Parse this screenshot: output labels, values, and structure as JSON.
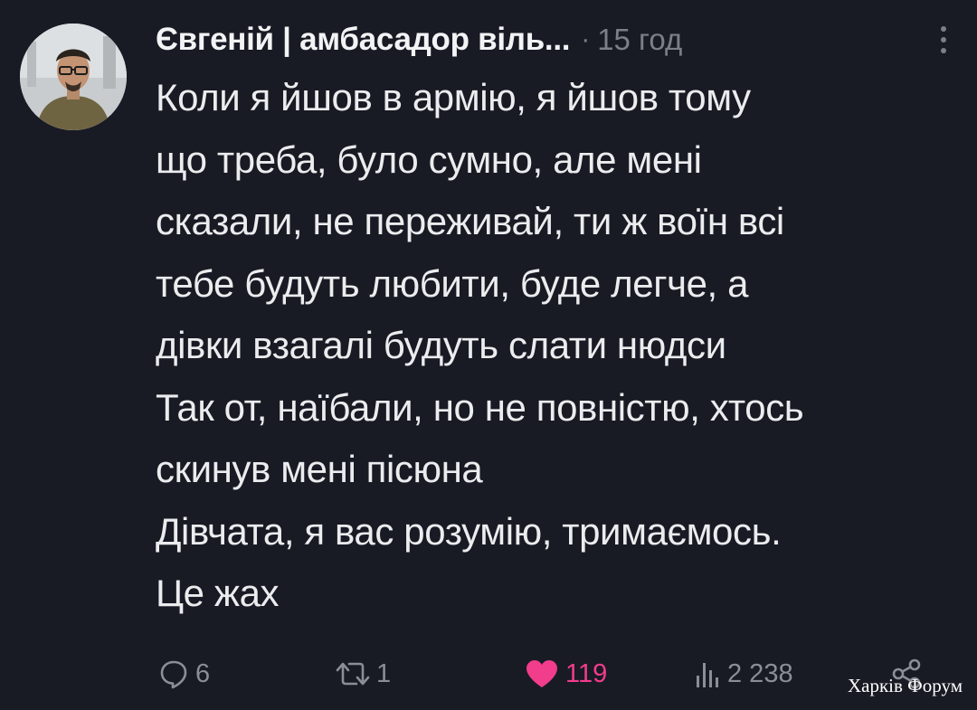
{
  "post": {
    "author": "Євгеній | амбасадор віль...",
    "separator": "·",
    "time": "15 год",
    "lines": [
      "Коли я йшов в армію, я йшов тому",
      "що треба, було сумно, але мені",
      "сказали, не переживай, ти ж воїн всі",
      "тебе будуть любити, буде легче, а",
      "дівки взагалі будуть слати нюдси",
      "Так от, наїбали, но не повністю, хтось",
      "скинув мені пісюна",
      "Дівчата, я вас розумію, тримаємось.",
      "Це жах"
    ]
  },
  "actions": {
    "replies": "6",
    "reposts": "1",
    "likes": "119",
    "views": "2 238"
  },
  "icons": {
    "reply": "reply-bubble-icon",
    "repost": "repost-arrows-icon",
    "like": "heart-filled-icon",
    "views": "bar-chart-icon",
    "share": "share-nodes-icon",
    "more": "vertical-dots-icon"
  },
  "colors": {
    "background": "#181b24",
    "text": "#ebecee",
    "muted": "#8a8e96",
    "like_accent": "#f23c8c"
  },
  "watermark": "Харків Форум"
}
